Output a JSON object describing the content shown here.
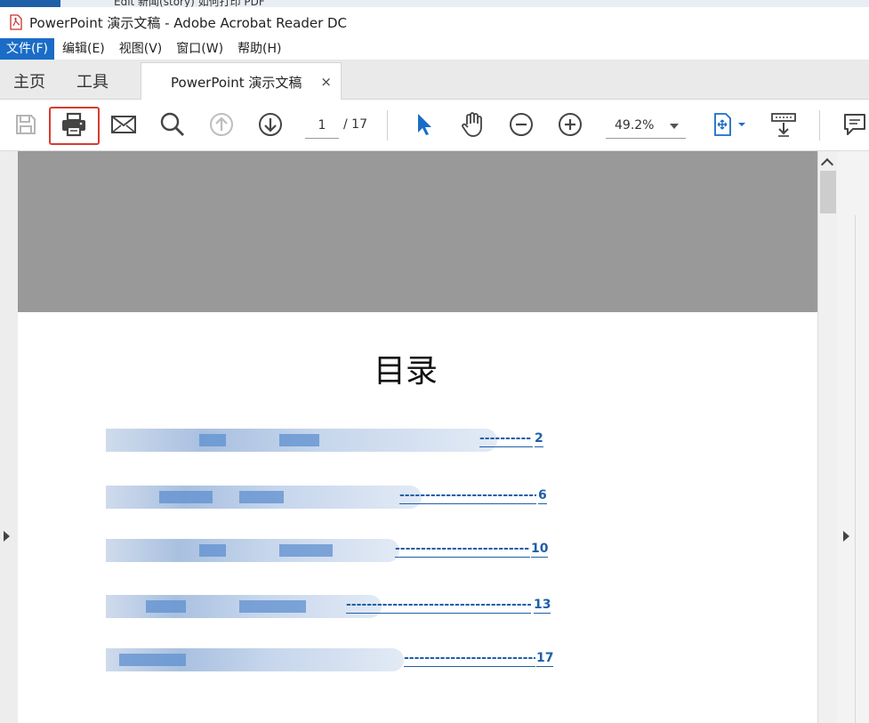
{
  "window": {
    "title": "PowerPoint 演示文稿 - Adobe Acrobat Reader DC",
    "top_tab_partial": "Edit 新闻(story) 如何打印 PDF"
  },
  "menu": [
    "文件(F)",
    "编辑(E)",
    "视图(V)",
    "窗口(W)",
    "帮助(H)"
  ],
  "nav_tabs": {
    "home": "主页",
    "tools": "工具"
  },
  "doc_tab": {
    "label": "PowerPoint 演示文稿",
    "close": "×"
  },
  "toolbar": {
    "page_current": "1",
    "page_total": "/ 17",
    "zoom": "49.2%"
  },
  "document": {
    "toc_title": "目录",
    "toc_entries": [
      {
        "page": "2"
      },
      {
        "page": "6"
      },
      {
        "page": "10"
      },
      {
        "page": "13"
      },
      {
        "page": "17"
      }
    ]
  },
  "colors": {
    "accent": "#1a6cc7",
    "highlight_border": "#d83b2f",
    "link": "#1f5fa8",
    "banner": "#999999"
  }
}
